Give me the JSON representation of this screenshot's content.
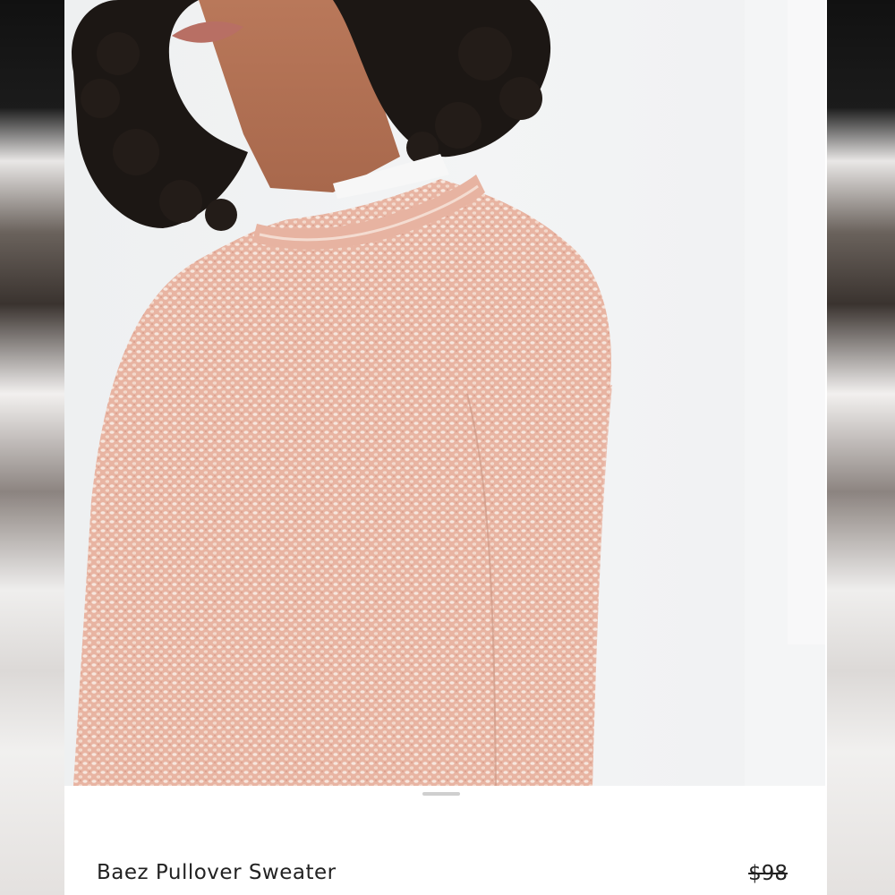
{
  "product": {
    "name": "Baez Pullover Sweater",
    "original_price": "$98"
  },
  "photo": {
    "subject": "sweater-photo",
    "sweater_color": "#e9b9a8"
  }
}
